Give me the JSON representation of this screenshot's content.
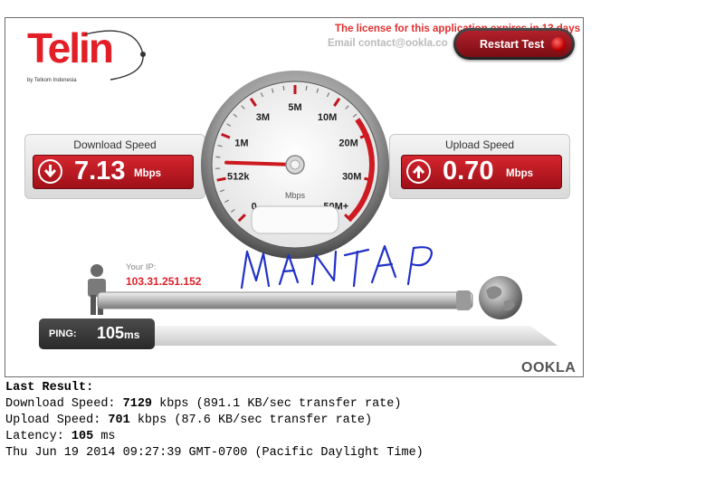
{
  "logo": {
    "text": "Telin",
    "sub": "by Telkom Indonesia"
  },
  "header": {
    "license": "The license for this application expires in 13 days",
    "email": "Email contact@ookla.co",
    "restart_label": "Restart Test"
  },
  "download": {
    "title": "Download Speed",
    "value": "7.13",
    "unit": "Mbps"
  },
  "upload": {
    "title": "Upload Speed",
    "value": "0.70",
    "unit": "Mbps"
  },
  "gauge": {
    "labels": [
      "0",
      "512k",
      "1M",
      "3M",
      "5M",
      "10M",
      "20M",
      "30M",
      "50M+"
    ],
    "unit": "Mbps",
    "needle_value_mbps": 0.7
  },
  "ip": {
    "label": "Your IP:",
    "value": "103.31.251.152"
  },
  "ping": {
    "label": "PING:",
    "value": "105",
    "unit": "ms"
  },
  "handwriting": "MANTAP",
  "brand": "OOKLA",
  "results": {
    "heading": "Last Result:",
    "download_prefix": "Download Speed: ",
    "download_value": "7129",
    "download_suffix": " kbps (891.1 KB/sec transfer rate)",
    "upload_prefix": "Upload Speed: ",
    "upload_value": "701",
    "upload_suffix": " kbps (87.6 KB/sec transfer rate)",
    "latency_prefix": "Latency: ",
    "latency_value": "105",
    "latency_suffix": " ms",
    "timestamp": "Thu Jun 19 2014 09:27:39 GMT-0700 (Pacific Daylight Time)"
  },
  "colors": {
    "accent": "#d7262f",
    "dark": "#2a2a2a"
  }
}
